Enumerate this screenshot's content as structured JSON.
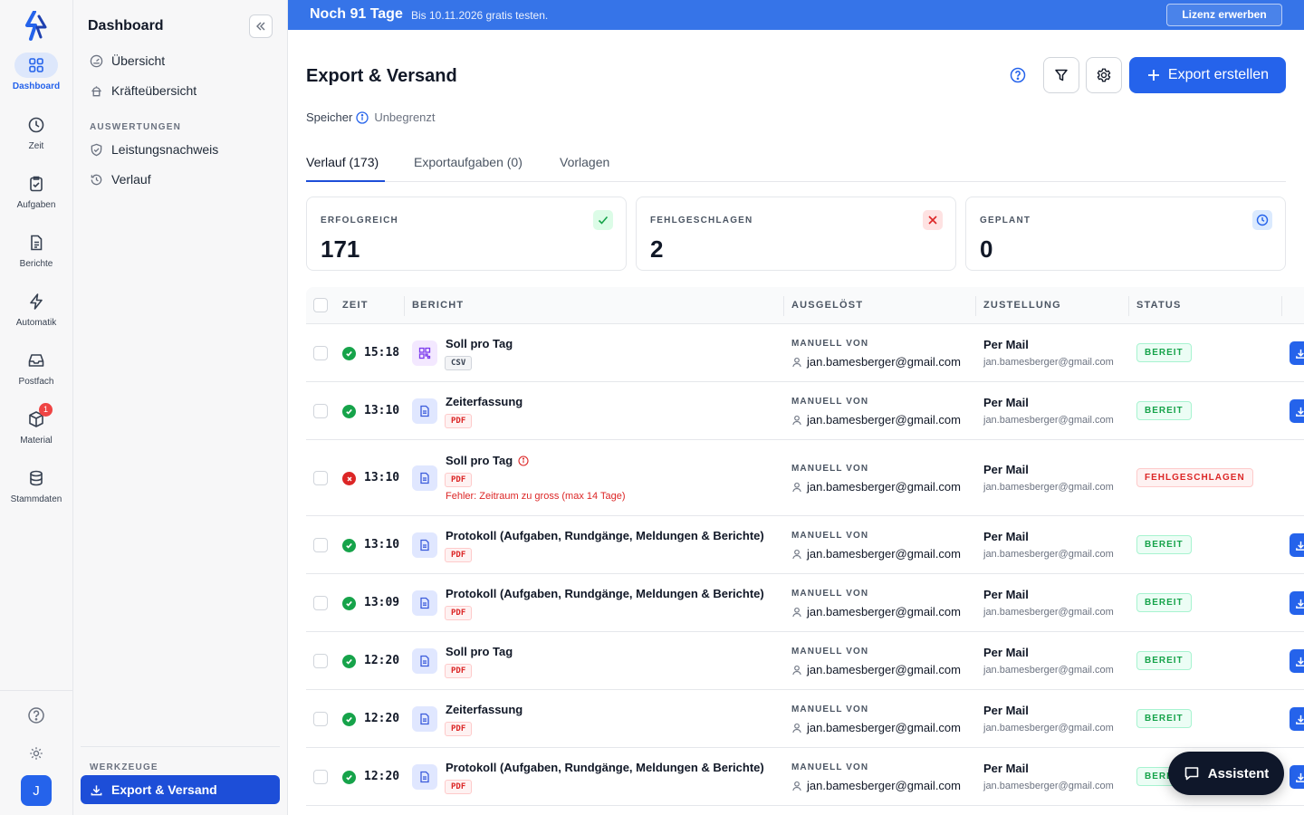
{
  "rail": {
    "items": [
      {
        "label": "Dashboard",
        "icon": "grid-icon",
        "active": true
      },
      {
        "label": "Zeit",
        "icon": "clock-icon"
      },
      {
        "label": "Aufgaben",
        "icon": "clipboard-icon"
      },
      {
        "label": "Berichte",
        "icon": "document-icon"
      },
      {
        "label": "Automatik",
        "icon": "bolt-icon"
      },
      {
        "label": "Postfach",
        "icon": "inbox-icon"
      },
      {
        "label": "Material",
        "icon": "box-icon",
        "badge": "1"
      },
      {
        "label": "Stammdaten",
        "icon": "database-icon"
      }
    ],
    "avatar": "J"
  },
  "nav": {
    "title": "Dashboard",
    "items": [
      {
        "label": "Übersicht",
        "icon": "gauge-icon"
      },
      {
        "label": "Kräfteübersicht",
        "icon": "workers-icon"
      }
    ],
    "section_auswertungen": "AUSWERTUNGEN",
    "auswertungen": [
      {
        "label": "Leistungsnachweis",
        "icon": "shield-check-icon"
      },
      {
        "label": "Verlauf",
        "icon": "history-icon"
      }
    ],
    "section_werkzeuge": "WERKZEUGE",
    "werkzeuge": [
      {
        "label": "Export & Versand",
        "icon": "download-icon",
        "active": true
      }
    ]
  },
  "banner": {
    "title": "Noch 91 Tage",
    "subtitle": "Bis 10.11.2026 gratis testen.",
    "button": "Lizenz erwerben"
  },
  "page": {
    "title": "Export & Versand",
    "create_button": "Export erstellen",
    "storage_label": "Speicher",
    "storage_value": "Unbegrenzt"
  },
  "tabs": [
    "Verlauf (173)",
    "Exportaufgaben (0)",
    "Vorlagen"
  ],
  "stats": [
    {
      "title": "ERFOLGREICH",
      "value": "171",
      "kind": "ok"
    },
    {
      "title": "FEHLGESCHLAGEN",
      "value": "2",
      "kind": "err"
    },
    {
      "title": "GEPLANT",
      "value": "0",
      "kind": "plan"
    }
  ],
  "table": {
    "headers": {
      "zeit": "ZEIT",
      "bericht": "BERICHT",
      "ausgeloest": "AUSGELÖST",
      "zustellung": "ZUSTELLUNG",
      "status": "STATUS"
    },
    "rows": [
      {
        "status_icon": "ok",
        "time": "15:18",
        "type": "csv",
        "name": "Soll pro Tag",
        "format": "CSV",
        "trigger_label": "MANUELL VON",
        "trigger_user": "jan.bamesberger@gmail.com",
        "delivery": "Per Mail",
        "delivery_addr": "jan.bamesberger@gmail.com",
        "status": "BEREIT",
        "status_kind": "ok"
      },
      {
        "status_icon": "ok",
        "time": "13:10",
        "type": "pdf",
        "name": "Zeiterfassung",
        "format": "PDF",
        "trigger_label": "MANUELL VON",
        "trigger_user": "jan.bamesberger@gmail.com",
        "delivery": "Per Mail",
        "delivery_addr": "jan.bamesberger@gmail.com",
        "status": "BEREIT",
        "status_kind": "ok"
      },
      {
        "status_icon": "err",
        "time": "13:10",
        "type": "pdf",
        "name": "Soll pro Tag",
        "format": "PDF",
        "error": "Fehler: Zeitraum zu gross (max 14 Tage)",
        "trigger_label": "MANUELL VON",
        "trigger_user": "jan.bamesberger@gmail.com",
        "delivery": "Per Mail",
        "delivery_addr": "jan.bamesberger@gmail.com",
        "status": "FEHLGESCHLAGEN",
        "status_kind": "err"
      },
      {
        "status_icon": "ok",
        "time": "13:10",
        "type": "pdf",
        "name": "Protokoll (Aufgaben, Rundgänge, Meldungen & Berichte)",
        "format": "PDF",
        "trigger_label": "MANUELL VON",
        "trigger_user": "jan.bamesberger@gmail.com",
        "delivery": "Per Mail",
        "delivery_addr": "jan.bamesberger@gmail.com",
        "status": "BEREIT",
        "status_kind": "ok"
      },
      {
        "status_icon": "ok",
        "time": "13:09",
        "type": "pdf",
        "name": "Protokoll (Aufgaben, Rundgänge, Meldungen & Berichte)",
        "format": "PDF",
        "trigger_label": "MANUELL VON",
        "trigger_user": "jan.bamesberger@gmail.com",
        "delivery": "Per Mail",
        "delivery_addr": "jan.bamesberger@gmail.com",
        "status": "BEREIT",
        "status_kind": "ok"
      },
      {
        "status_icon": "ok",
        "time": "12:20",
        "type": "pdf",
        "name": "Soll pro Tag",
        "format": "PDF",
        "trigger_label": "MANUELL VON",
        "trigger_user": "jan.bamesberger@gmail.com",
        "delivery": "Per Mail",
        "delivery_addr": "jan.bamesberger@gmail.com",
        "status": "BEREIT",
        "status_kind": "ok"
      },
      {
        "status_icon": "ok",
        "time": "12:20",
        "type": "pdf",
        "name": "Zeiterfassung",
        "format": "PDF",
        "trigger_label": "MANUELL VON",
        "trigger_user": "jan.bamesberger@gmail.com",
        "delivery": "Per Mail",
        "delivery_addr": "jan.bamesberger@gmail.com",
        "status": "BEREIT",
        "status_kind": "ok"
      },
      {
        "status_icon": "ok",
        "time": "12:20",
        "type": "pdf",
        "name": "Protokoll (Aufgaben, Rundgänge, Meldungen & Berichte)",
        "format": "PDF",
        "trigger_label": "MANUELL VON",
        "trigger_user": "jan.bamesberger@gmail.com",
        "delivery": "Per Mail",
        "delivery_addr": "jan.bamesberger@gmail.com",
        "status": "BEREIT",
        "status_kind": "ok"
      }
    ]
  },
  "assistant": {
    "label": "Assistent"
  },
  "colors": {
    "accent": "#2563eb",
    "banner": "#3674e8",
    "success": "#16a34a",
    "danger": "#dc2626",
    "sidebar_bg": "#f7f7f8"
  }
}
